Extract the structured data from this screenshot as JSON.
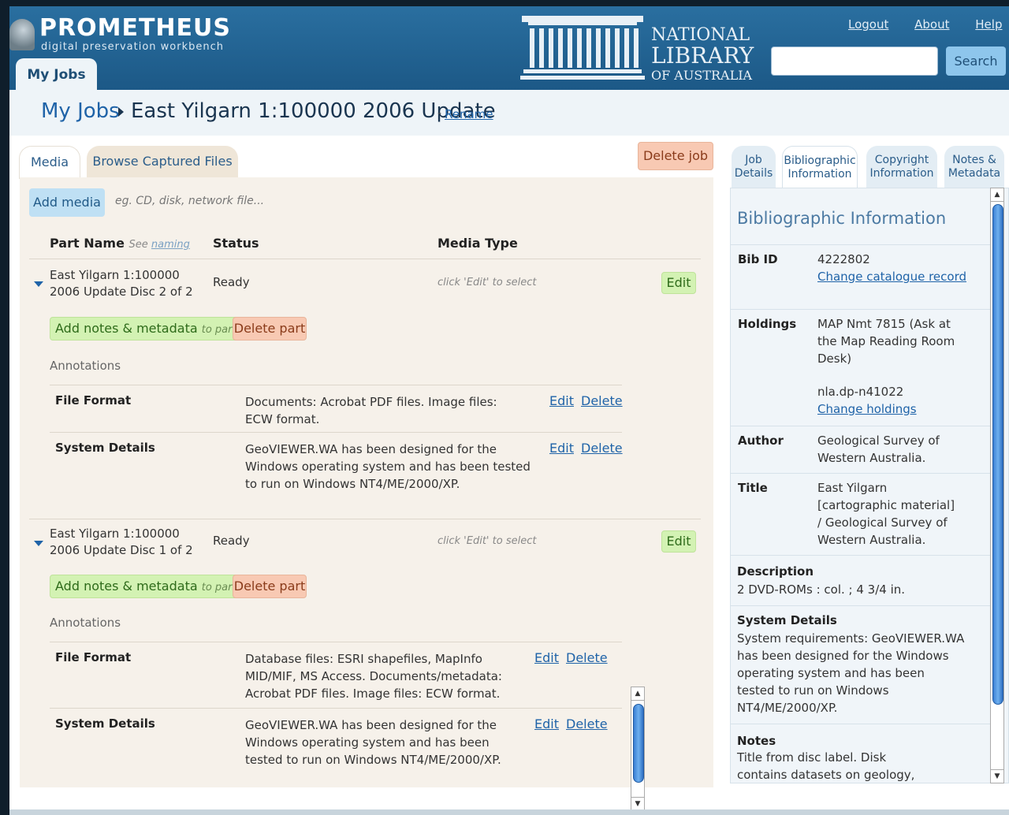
{
  "header": {
    "app_name": "PROMETHEUS",
    "tagline": "digital preservation workbench",
    "nla_line1": "NATIONAL",
    "nla_line2": "LIBRARY",
    "nla_line3": "OF AUSTRALIA",
    "links": {
      "logout": "Logout",
      "about": "About",
      "help": "Help"
    },
    "search": {
      "value": "",
      "placeholder": "",
      "button_label": "Search"
    },
    "my_jobs_tab": "My Jobs"
  },
  "breadcrumb": {
    "root": "My Jobs",
    "job_title": "East Yilgarn 1:100000 2006 Update",
    "dash": "-",
    "rename": "Rename"
  },
  "left_tabs": {
    "media": "Media",
    "browse": "Browse Captured Files"
  },
  "delete_job": "Delete job",
  "media": {
    "add_media": "Add media",
    "hint": "eg. CD, disk, network file...",
    "columns": {
      "part_name": "Part Name",
      "see": "See",
      "naming": "naming",
      "status": "Status",
      "media_type": "Media Type"
    },
    "parts": [
      {
        "name": "East Yilgarn 1:100000 2006 Update Disc 2 of 2",
        "status": "Ready",
        "media_type": "click 'Edit' to select",
        "edit": "Edit",
        "add_notes": "Add notes & metadata",
        "to_part": "to part",
        "delete_part": "Delete part",
        "annotations_label": "Annotations",
        "annotations": [
          {
            "label": "File Format",
            "value": "Documents: Acrobat PDF files. Image files: ECW format.",
            "edit": "Edit",
            "delete": "Delete"
          },
          {
            "label": "System Details",
            "value": "GeoVIEWER.WA has been designed for the Windows operating system and has been tested to run on Windows NT4/ME/2000/XP.",
            "edit": "Edit",
            "delete": "Delete"
          }
        ]
      },
      {
        "name": "East Yilgarn 1:100000 2006 Update Disc 1 of 2",
        "status": "Ready",
        "media_type": "click 'Edit' to select",
        "edit": "Edit",
        "add_notes": "Add notes & metadata",
        "to_part": "to part",
        "delete_part": "Delete part",
        "annotations_label": "Annotations",
        "annotations": [
          {
            "label": "File Format",
            "value": "Database files: ESRI shapefiles, MapInfo MID/MIF, MS Access. Documents/metadata: Acrobat PDF files. Image files: ECW format.",
            "edit": "Edit",
            "delete": "Delete"
          },
          {
            "label": "System Details",
            "value": "GeoVIEWER.WA has been designed for the Windows operating system and has been tested to run on Windows NT4/ME/2000/XP.",
            "edit": "Edit",
            "delete": "Delete"
          }
        ]
      }
    ]
  },
  "right_tabs": {
    "job_details": [
      "Job",
      "Details"
    ],
    "bibliographic": [
      "Bibliographic",
      "Information"
    ],
    "copyright": [
      "Copyright",
      "Information"
    ],
    "notes": [
      "Notes &",
      "Metadata"
    ]
  },
  "bib": {
    "title": "Bibliographic Information",
    "bib_id_label": "Bib ID",
    "bib_id": "4222802",
    "change_catalogue": "Change catalogue record",
    "holdings_label": "Holdings",
    "holdings": "MAP Nmt 7815 (Ask at the Map Reading Room Desk)",
    "holdings_id": "nla.dp-n41022",
    "change_holdings": "Change holdings",
    "author_label": "Author",
    "author": "Geological Survey of Western Australia.",
    "title_label": "Title",
    "title_value": "East Yilgarn [cartographic material] / Geological Survey of Western Australia.",
    "description_label": "Description",
    "description": "2 DVD-ROMs : col. ; 4 3/4 in.",
    "system_details_label": "System Details",
    "system_details": "System requirements: GeoVIEWER.WA has been designed for the Windows operating system and has been tested to run on Windows NT4/ME/2000/XP.",
    "notes_label": "Notes",
    "notes": "Title from disc label. Disk contains datasets on geology, geophysics,"
  },
  "colors": {
    "header_blue": "#1d5a88",
    "link": "#1f63a8",
    "green_button": "#d3f2b3",
    "red_button": "#f8c9b3",
    "blue_button": "#bfe0f4"
  }
}
